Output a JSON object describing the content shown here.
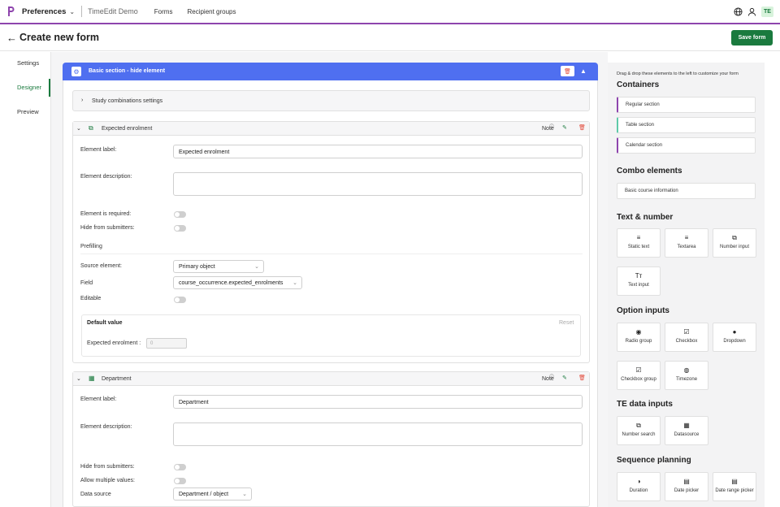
{
  "topbar": {
    "app_name": "Preferences",
    "org_name": "TimeEdit Demo",
    "nav": [
      "Forms",
      "Recipient groups"
    ],
    "user_badge": "TE",
    "accent": "#8e44ad"
  },
  "header": {
    "title": "Create new form",
    "save_label": "Save form",
    "save_color": "#1a7a3e"
  },
  "sidenav": {
    "items": [
      "Settings",
      "Designer",
      "Preview"
    ],
    "active": "Designer"
  },
  "section": {
    "title": "Basic section - hide element",
    "color": "#4f6ff0",
    "study_label": "Study combinations settings"
  },
  "card1": {
    "title": "Expected enrolment",
    "note": "Note",
    "element_label_label": "Element label:",
    "element_label_value": "Expected enrolment",
    "element_description_label": "Element description:",
    "required_label": "Element is required:",
    "hide_label": "Hide from submitters:",
    "prefilling_label": "Prefilling",
    "source_label": "Source element:",
    "source_value": "Primary object",
    "field_label": "Field",
    "field_value": "course_occurrence.expected_enrolments",
    "editable_label": "Editable",
    "default_title": "Default value",
    "reset_label": "Reset",
    "default_field_label": "Expected enrolment :",
    "default_field_value": "0"
  },
  "card2": {
    "title": "Department",
    "note": "Note",
    "element_label_label": "Element label:",
    "element_label_value": "Department",
    "element_description_label": "Element description:",
    "hide_label": "Hide from submitters:",
    "multiple_label": "Allow multiple values:",
    "datasource_label": "Data source",
    "datasource_value": "Department / object"
  },
  "palette": {
    "hint": "Drag & drop these elements to the left to customize your form",
    "containers_title": "Containers",
    "containers": [
      {
        "label": "Regular section",
        "color": "#8e44ad"
      },
      {
        "label": "Table section",
        "color": "#5ec9a8"
      },
      {
        "label": "Calendar section",
        "color": "#8e44ad"
      }
    ],
    "combo_title": "Combo elements",
    "combo": [
      "Basic course information"
    ],
    "text_title": "Text & number",
    "text_items": [
      {
        "icon": "≡",
        "label": "Static text"
      },
      {
        "icon": "≡",
        "label": "Textarea"
      },
      {
        "icon": "⧉",
        "label": "Number input"
      },
      {
        "icon": "Tт",
        "label": "Text input"
      }
    ],
    "option_title": "Option inputs",
    "option_items": [
      {
        "icon": "◉",
        "label": "Radio group"
      },
      {
        "icon": "☑",
        "label": "Checkbox"
      },
      {
        "icon": "●",
        "label": "Dropdown"
      },
      {
        "icon": "☑",
        "label": "Checkbox group"
      },
      {
        "icon": "◍",
        "label": "Timezone"
      }
    ],
    "te_title": "TE data inputs",
    "te_items": [
      {
        "icon": "⧉",
        "label": "Number search"
      },
      {
        "icon": "▦",
        "label": "Datasource"
      }
    ],
    "seq_title": "Sequence planning",
    "seq_items": [
      {
        "icon": "◑",
        "label": "Duration"
      },
      {
        "icon": "▤",
        "label": "Date picker"
      },
      {
        "icon": "▤",
        "label": "Date range picker"
      }
    ]
  }
}
